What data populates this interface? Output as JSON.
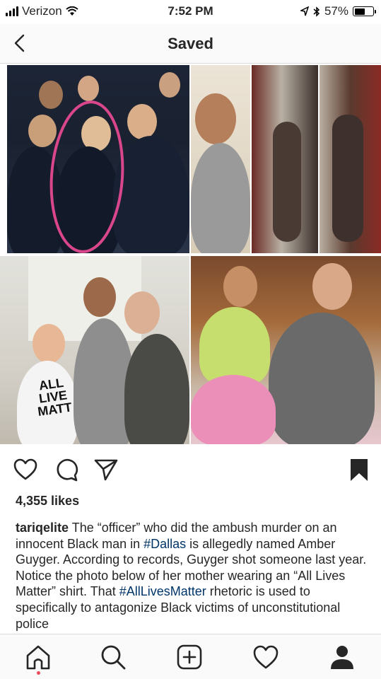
{
  "status_bar": {
    "carrier": "Verizon",
    "time": "7:52 PM",
    "battery": "57%",
    "battery_level": 0.57
  },
  "nav": {
    "title": "Saved",
    "back_icon": "chevron-left-icon"
  },
  "post": {
    "likes": "4,355 likes",
    "username": "tariqelite",
    "caption_parts": [
      {
        "text": " The “officer” who did the ambush murder on an innocent Black man in ",
        "type": "text"
      },
      {
        "text": "#Dallas",
        "type": "hashtag"
      },
      {
        "text": " is allegedly named Amber Guyger. According to records, Guyger shot someone last year. Notice the photo below of her mother wearing an “All Lives Matter” shirt. That ",
        "type": "text"
      },
      {
        "text": "#AllLivesMatter",
        "type": "hashtag"
      },
      {
        "text": " rhetoric is used to specifically to antagonize Black victims of unconstitutional police",
        "type": "text"
      }
    ],
    "shirt_text": [
      "ALL",
      "LIVE",
      "MATT"
    ]
  },
  "actions": {
    "like_icon": "heart-icon",
    "comment_icon": "comment-icon",
    "share_icon": "send-icon",
    "save_icon": "bookmark-filled-icon"
  },
  "tabbar": [
    "home-icon",
    "search-icon",
    "add-icon",
    "activity-heart-icon",
    "profile-icon"
  ],
  "colors": {
    "text": "#262626",
    "hashtag": "#003569",
    "notification_dot": "#ed4956",
    "circle_annotation": "#d9468c"
  }
}
